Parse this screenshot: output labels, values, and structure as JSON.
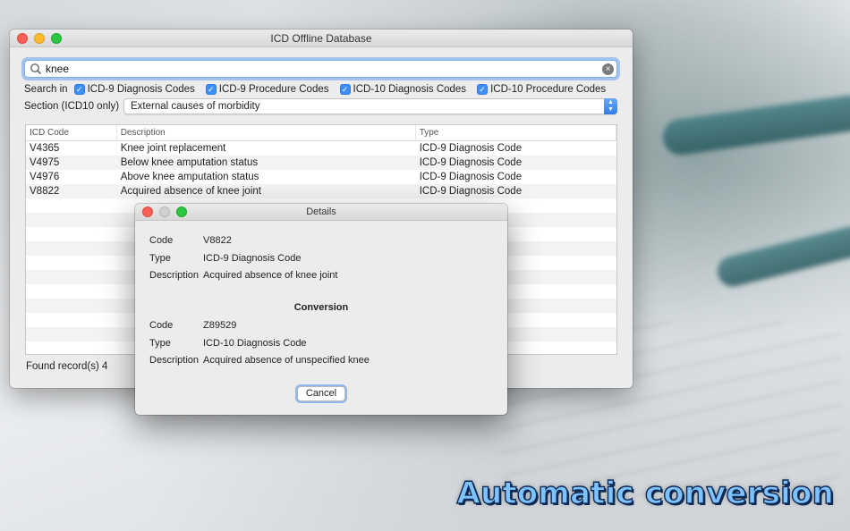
{
  "promo": {
    "text": "Automatic conversion"
  },
  "main_window": {
    "title": "ICD Offline Database",
    "search": {
      "value": "knee",
      "placeholder": ""
    },
    "search_in": {
      "label": "Search in",
      "options": [
        {
          "label": "ICD-9 Diagnosis Codes",
          "checked": true
        },
        {
          "label": "ICD-9 Procedure Codes",
          "checked": true
        },
        {
          "label": "ICD-10 Diagnosis Codes",
          "checked": true
        },
        {
          "label": "ICD-10 Procedure Codes",
          "checked": true
        }
      ]
    },
    "section": {
      "label": "Section (ICD10 only)",
      "value": "External causes of morbidity"
    },
    "table": {
      "columns": [
        "ICD Code",
        "Description",
        "Type"
      ],
      "rows": [
        [
          "V4365",
          "Knee joint replacement",
          "ICD-9 Diagnosis Code"
        ],
        [
          "V4975",
          "Below knee amputation status",
          "ICD-9 Diagnosis Code"
        ],
        [
          "V4976",
          "Above knee amputation status",
          "ICD-9 Diagnosis Code"
        ],
        [
          "V8822",
          "Acquired absence of knee joint",
          "ICD-9 Diagnosis Code"
        ]
      ]
    },
    "found_text": "Found record(s) 4"
  },
  "details_dialog": {
    "title": "Details",
    "code_label": "Code",
    "code_value": "V8822",
    "type_label": "Type",
    "type_value": "ICD-9 Diagnosis Code",
    "desc_label": "Description",
    "desc_value": "Acquired absence of knee joint",
    "conversion_title": "Conversion",
    "conv_code_label": "Code",
    "conv_code_value": "Z89529",
    "conv_type_label": "Type",
    "conv_type_value": "ICD-10 Diagnosis Code",
    "conv_desc_label": "Description",
    "conv_desc_value": "Acquired absence of unspecified knee",
    "cancel_label": "Cancel"
  },
  "colors": {
    "accent": "#3d8ff7",
    "promo_text": "#7ec3ff",
    "promo_outline": "#0d2a55"
  }
}
